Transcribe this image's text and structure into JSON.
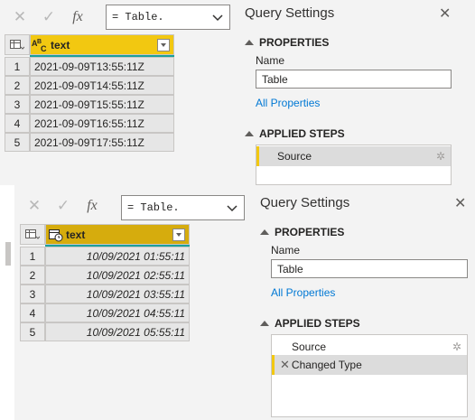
{
  "top": {
    "formula": {
      "value": "= Table.",
      "fx_label": "fx"
    },
    "column": {
      "name": "text",
      "type_icon": "ABC"
    },
    "rows": [
      {
        "num": "1",
        "value": "2021-09-09T13:55:11Z"
      },
      {
        "num": "2",
        "value": "2021-09-09T14:55:11Z"
      },
      {
        "num": "3",
        "value": "2021-09-09T15:55:11Z"
      },
      {
        "num": "4",
        "value": "2021-09-09T16:55:11Z"
      },
      {
        "num": "5",
        "value": "2021-09-09T17:55:11Z"
      }
    ],
    "settings": {
      "title": "Query Settings",
      "properties_label": "PROPERTIES",
      "name_label": "Name",
      "name_value": "Table",
      "all_properties": "All Properties",
      "applied_steps_label": "APPLIED STEPS",
      "steps": [
        "Source"
      ]
    }
  },
  "bottom": {
    "formula": {
      "value": "= Table.",
      "fx_label": "fx"
    },
    "column": {
      "name": "text",
      "type_icon": "datetimezone"
    },
    "rows": [
      {
        "num": "1",
        "value": "10/09/2021 01:55:11"
      },
      {
        "num": "2",
        "value": "10/09/2021 02:55:11"
      },
      {
        "num": "3",
        "value": "10/09/2021 03:55:11"
      },
      {
        "num": "4",
        "value": "10/09/2021 04:55:11"
      },
      {
        "num": "5",
        "value": "10/09/2021 05:55:11"
      }
    ],
    "settings": {
      "title": "Query Settings",
      "properties_label": "PROPERTIES",
      "name_label": "Name",
      "name_value": "Table",
      "all_properties": "All Properties",
      "applied_steps_label": "APPLIED STEPS",
      "steps": [
        "Source",
        "Changed Type"
      ]
    }
  },
  "colors": {
    "header_yellow": "#f2c811",
    "header_gold": "#d6ac0d",
    "quality_bar": "#1aa09c",
    "link": "#0078d4"
  }
}
